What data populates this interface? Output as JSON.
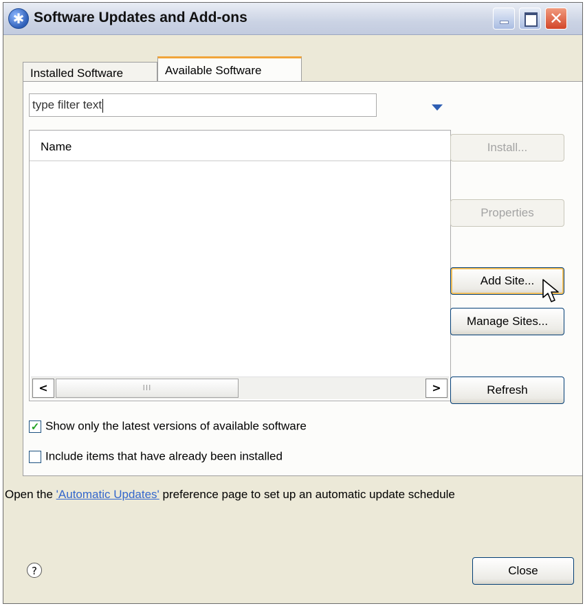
{
  "window": {
    "title": "Software Updates and Add-ons",
    "app_icon": "eclipse-update-icon",
    "controls": {
      "minimize": "minimize-icon",
      "maximize": "maximize-icon",
      "close": "close-icon",
      "close_glyph": "✕"
    }
  },
  "tabs": [
    {
      "label": "Installed Software",
      "selected": false
    },
    {
      "label": "Available Software",
      "selected": true
    }
  ],
  "filter": {
    "value": "type filter text",
    "dropdown_icon": "chevron-down-icon"
  },
  "table": {
    "columns": [
      "Name"
    ],
    "rows": [],
    "scroll": {
      "left_glyph": "<",
      "right_glyph": ">",
      "thumb_glyph": "III"
    }
  },
  "buttons": {
    "install": {
      "label": "Install...",
      "enabled": false
    },
    "properties": {
      "label": "Properties",
      "enabled": false
    },
    "add_site": {
      "label": "Add Site...",
      "enabled": true
    },
    "manage_sites": {
      "label": "Manage Sites...",
      "enabled": true
    },
    "refresh": {
      "label": "Refresh",
      "enabled": true
    }
  },
  "options": {
    "show_latest": {
      "label": "Show only the latest versions of available software",
      "checked": true
    },
    "include_installed": {
      "label": "Include items that have already been installed",
      "checked": false
    }
  },
  "info": {
    "prefix": "Open the ",
    "link": "'Automatic Updates'",
    "suffix": " preference page to set up an automatic update schedule"
  },
  "footer": {
    "help_glyph": "?",
    "close_label": "Close"
  },
  "colors": {
    "accent_tab": "#f0a43a",
    "link": "#3366cc",
    "check": "#21a121"
  }
}
